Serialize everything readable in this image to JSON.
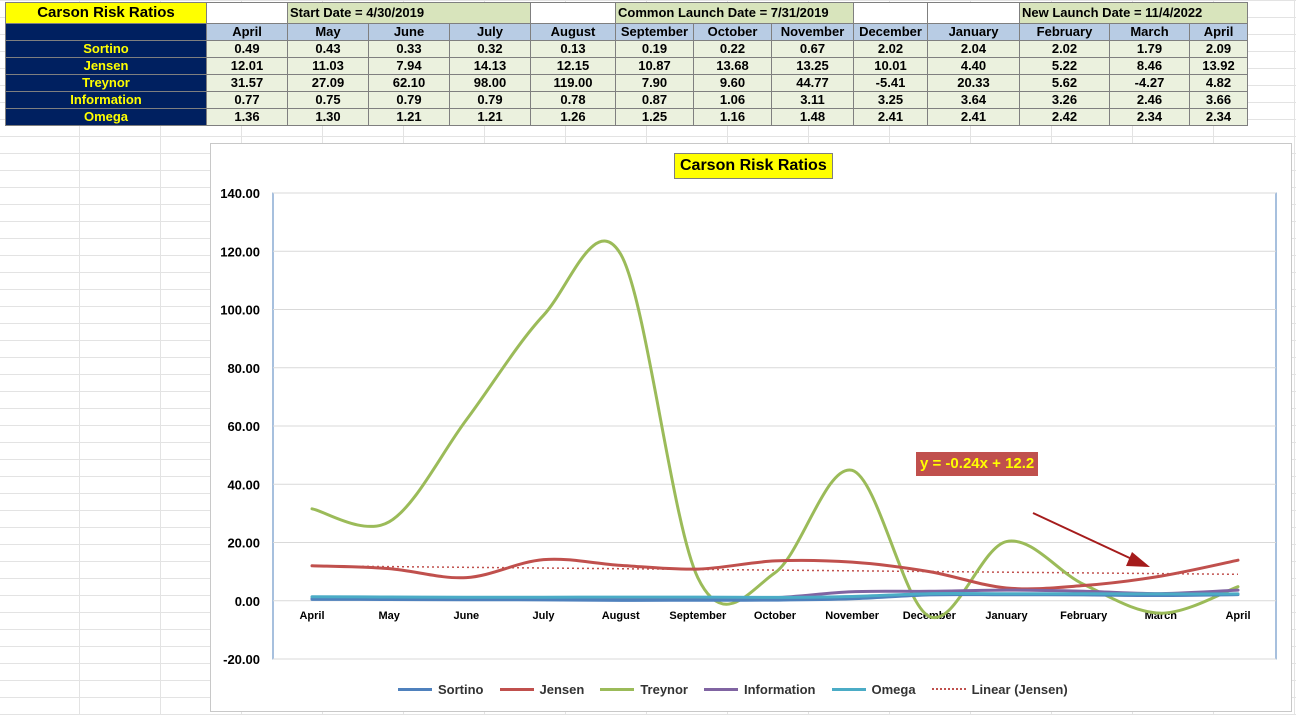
{
  "sheet": {
    "title": "Carson Risk Ratios",
    "start_date": "Start Date = 4/30/2019",
    "common_launch": "Common Launch Date = 7/31/2019",
    "new_launch": "New Launch Date = 11/4/2022",
    "months": [
      "April",
      "May",
      "June",
      "July",
      "August",
      "September",
      "October",
      "November",
      "December",
      "January",
      "February",
      "March",
      "April"
    ],
    "rows": [
      {
        "label": "Sortino",
        "values": [
          "0.49",
          "0.43",
          "0.33",
          "0.32",
          "0.13",
          "0.19",
          "0.22",
          "0.67",
          "2.02",
          "2.04",
          "2.02",
          "1.79",
          "2.09"
        ]
      },
      {
        "label": "Jensen",
        "values": [
          "12.01",
          "11.03",
          "7.94",
          "14.13",
          "12.15",
          "10.87",
          "13.68",
          "13.25",
          "10.01",
          "4.40",
          "5.22",
          "8.46",
          "13.92"
        ]
      },
      {
        "label": "Treynor",
        "values": [
          "31.57",
          "27.09",
          "62.10",
          "98.00",
          "119.00",
          "7.90",
          "9.60",
          "44.77",
          "-5.41",
          "20.33",
          "5.62",
          "-4.27",
          "4.82"
        ]
      },
      {
        "label": "Information",
        "values": [
          "0.77",
          "0.75",
          "0.79",
          "0.79",
          "0.78",
          "0.87",
          "1.06",
          "3.11",
          "3.25",
          "3.64",
          "3.26",
          "2.46",
          "3.66"
        ]
      },
      {
        "label": "Omega",
        "values": [
          "1.36",
          "1.30",
          "1.21",
          "1.21",
          "1.26",
          "1.25",
          "1.16",
          "1.48",
          "2.41",
          "2.41",
          "2.42",
          "2.34",
          "2.34"
        ]
      }
    ]
  },
  "chart_data": {
    "type": "line",
    "title": "Carson Risk Ratios",
    "categories": [
      "April",
      "May",
      "June",
      "July",
      "August",
      "September",
      "October",
      "November",
      "December",
      "January",
      "February",
      "March",
      "April"
    ],
    "ylim": [
      -20,
      140
    ],
    "yticks": [
      "140.00",
      "120.00",
      "100.00",
      "80.00",
      "60.00",
      "40.00",
      "20.00",
      "0.00",
      "-20.00"
    ],
    "grid": true,
    "smooth": true,
    "legend_position": "bottom",
    "series": [
      {
        "name": "Sortino",
        "color": "#4f81bd",
        "values": [
          0.49,
          0.43,
          0.33,
          0.32,
          0.13,
          0.19,
          0.22,
          0.67,
          2.02,
          2.04,
          2.02,
          1.79,
          2.09
        ]
      },
      {
        "name": "Jensen",
        "color": "#c0504d",
        "values": [
          12.01,
          11.03,
          7.94,
          14.13,
          12.15,
          10.87,
          13.68,
          13.25,
          10.01,
          4.4,
          5.22,
          8.46,
          13.92
        ]
      },
      {
        "name": "Treynor",
        "color": "#9bbb59",
        "values": [
          31.57,
          27.09,
          62.1,
          98.0,
          119.0,
          7.9,
          9.6,
          44.77,
          -5.41,
          20.33,
          5.62,
          -4.27,
          4.82
        ]
      },
      {
        "name": "Information",
        "color": "#8064a2",
        "values": [
          0.77,
          0.75,
          0.79,
          0.79,
          0.78,
          0.87,
          1.06,
          3.11,
          3.25,
          3.64,
          3.26,
          2.46,
          3.66
        ]
      },
      {
        "name": "Omega",
        "color": "#4bacc6",
        "values": [
          1.36,
          1.3,
          1.21,
          1.21,
          1.26,
          1.25,
          1.16,
          1.48,
          2.41,
          2.41,
          2.42,
          2.34,
          2.34
        ]
      }
    ],
    "trendline": {
      "name": "Linear (Jensen)",
      "color": "#c0504d",
      "slope": -0.24,
      "intercept": 12.2,
      "equation": "y = -0.24x + 12.2"
    },
    "annotation": {
      "type": "arrow",
      "color": "#a51c1c"
    }
  }
}
